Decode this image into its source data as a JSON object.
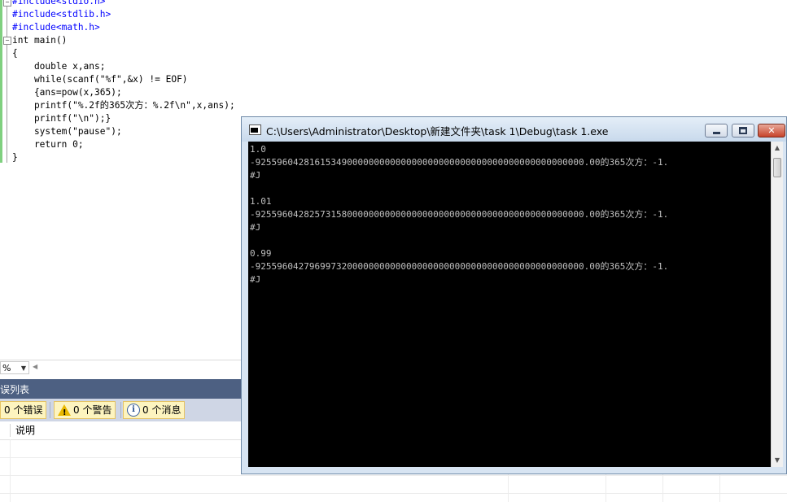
{
  "editor": {
    "lines": [
      "#include<stdio.h>",
      "#include<stdlib.h>",
      "#include<math.h>",
      "int main()",
      "{",
      "    double x,ans;",
      "    while(scanf(\"%f\",&x) != EOF)",
      "    {ans=pow(x,365);",
      "    printf(\"%.2f的365次方：%.2f\\n\",x,ans);",
      "    printf(\"\\n\");}",
      "    system(\"pause\");",
      "    return 0;",
      "}"
    ],
    "zoom": "%"
  },
  "error_list": {
    "title": "误列表",
    "errors_label": "0 个错误",
    "warnings_label": "0 个警告",
    "messages_label": "0 个消息",
    "column_description": "说明"
  },
  "console": {
    "title": "C:\\Users\\Administrator\\Desktop\\新建文件夹\\task 1\\Debug\\task 1.exe",
    "lines": [
      "1.0",
      "-9255960428161534900000000000000000000000000000000000000000000.00的365次方：-1.",
      "#J",
      "",
      "1.01",
      "-9255960428257315800000000000000000000000000000000000000000000.00的365次方：-1.",
      "#J",
      "",
      "0.99",
      "-9255960427969973200000000000000000000000000000000000000000000.00的365次方：-1.",
      "#J"
    ]
  },
  "colors": {
    "panel_title_bg": "#4d6082",
    "toolbar_bg": "#cfd6e5",
    "console_bg": "#000000",
    "console_fg": "#c0c0c0",
    "keyword": "#0000ff",
    "string": "#a31515"
  }
}
